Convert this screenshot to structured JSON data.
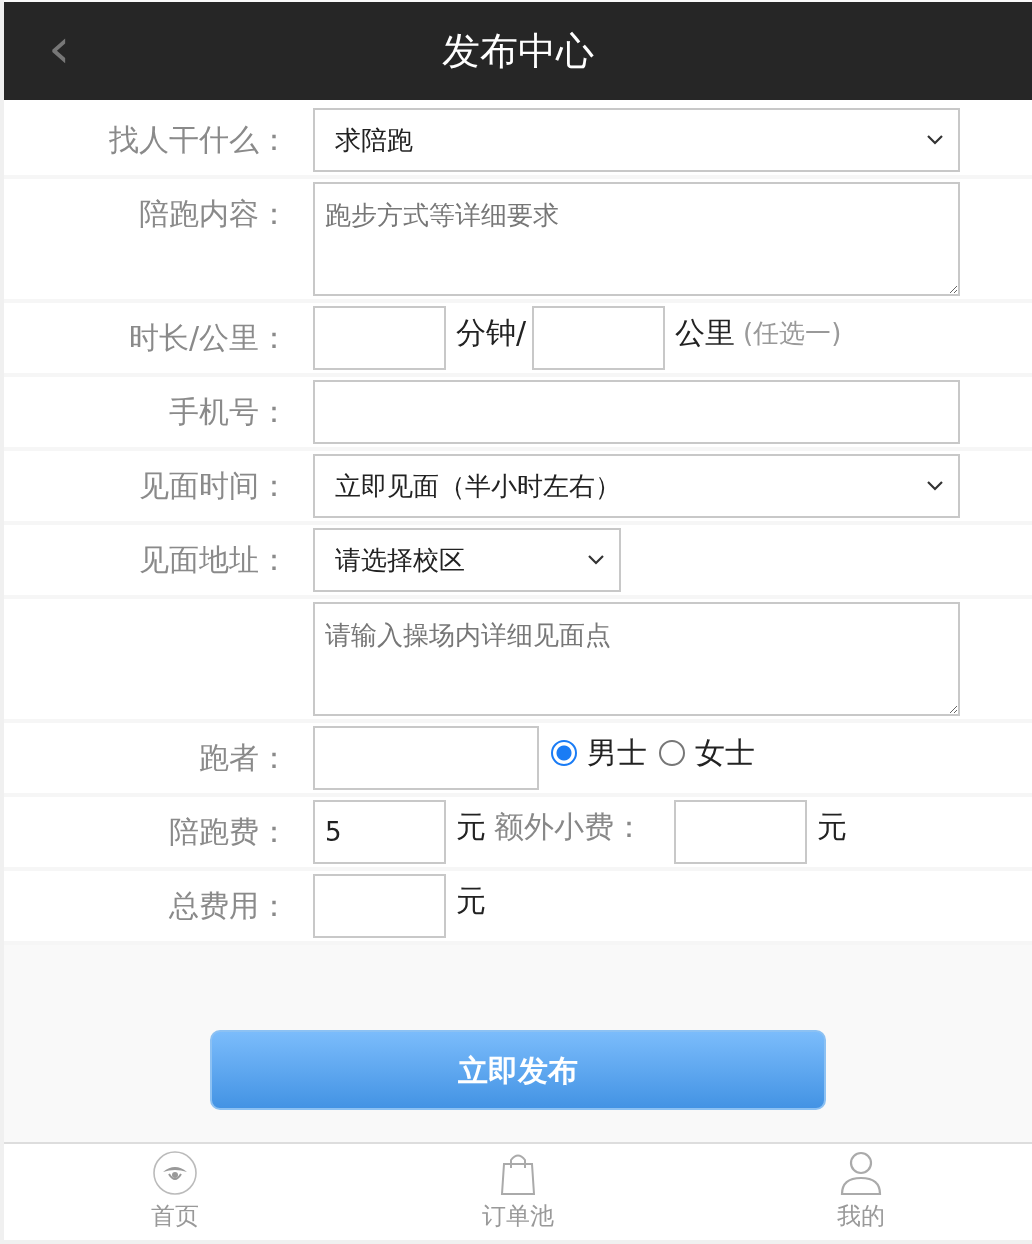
{
  "header": {
    "back": "‹",
    "title": "发布中心"
  },
  "rows": [
    {
      "label": "找人干什么：",
      "parts": [
        {
          "kind": "select",
          "value": "求陪跑"
        }
      ]
    },
    {
      "label": "陪跑内容：",
      "parts": [
        {
          "kind": "textarea",
          "placeholder": "跑步方式等详细要求"
        }
      ]
    },
    {
      "label": "时长/公里：",
      "parts": [
        {
          "kind": "input"
        },
        {
          "kind": "unit",
          "text": "分钟/"
        },
        {
          "kind": "input"
        },
        {
          "kind": "unit",
          "text": "公里"
        },
        {
          "kind": "note",
          "text": "(任选一)"
        }
      ]
    },
    {
      "label": "手机号：",
      "parts": [
        {
          "kind": "input"
        }
      ]
    },
    {
      "label": "见面时间：",
      "parts": [
        {
          "kind": "select",
          "value": "立即见面（半小时左右）"
        }
      ]
    },
    {
      "label": "见面地址：",
      "parts": [
        {
          "kind": "select",
          "value": "请选择校区"
        }
      ]
    },
    {
      "parts": [
        {
          "kind": "textarea",
          "placeholder": "请输入操场内详细见面点"
        }
      ]
    },
    {
      "label": "跑者：",
      "parts": [
        {
          "kind": "input"
        },
        {
          "kind": "radio",
          "label": "男士",
          "selected": true
        },
        {
          "kind": "radio",
          "label": "女士",
          "selected": false
        }
      ]
    },
    {
      "label": "陪跑费：",
      "parts": [
        {
          "kind": "input",
          "value": "5"
        },
        {
          "kind": "unit",
          "text": "元"
        },
        {
          "kind": "caption",
          "text": "额外小费："
        },
        {
          "kind": "input"
        },
        {
          "kind": "unit",
          "text": "元"
        }
      ]
    },
    {
      "label": "总费用：",
      "parts": [
        {
          "kind": "input"
        },
        {
          "kind": "unit",
          "text": "元"
        }
      ]
    }
  ],
  "submit": "立即发布",
  "nav": [
    {
      "label": "首页"
    },
    {
      "label": "订单池"
    },
    {
      "label": "我的"
    }
  ]
}
